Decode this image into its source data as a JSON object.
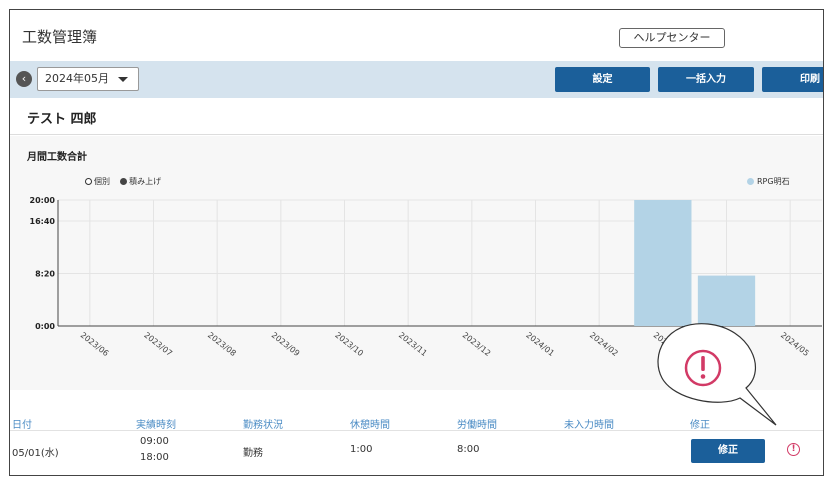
{
  "header": {
    "title": "工数管理簿",
    "help_label": "ヘルプセンター"
  },
  "toolbar": {
    "month": "2024年05月",
    "buttons": [
      {
        "label": "設定"
      },
      {
        "label": "一括入力"
      },
      {
        "label": "印刷"
      }
    ]
  },
  "user": {
    "name": "テスト 四郎"
  },
  "chart": {
    "title": "月間工数合計",
    "mode_individual": "個別",
    "mode_stacked": "積み上げ",
    "series_label": "RPG明石",
    "colors": {
      "bar": "#b3d3e6",
      "grid": "#e4e4e4"
    }
  },
  "chart_data": {
    "type": "bar",
    "categories": [
      "2023/06",
      "2023/07",
      "2023/08",
      "2023/09",
      "2023/10",
      "2023/11",
      "2023/12",
      "2024/01",
      "2024/02",
      "2024/03",
      "2024/04",
      "2024/05"
    ],
    "series": [
      {
        "name": "RPG明石",
        "values": [
          0,
          0,
          0,
          0,
          0,
          0,
          0,
          0,
          0,
          20,
          8,
          0
        ]
      }
    ],
    "yticks": [
      "0:00",
      "8:20",
      "16:40",
      "20:00"
    ],
    "ytick_values": [
      0,
      8.333,
      16.667,
      20
    ],
    "ylim": [
      0,
      20
    ],
    "legend": "top-right"
  },
  "table": {
    "headers": [
      "日付",
      "実績時刻",
      "勤務状況",
      "休憩時間",
      "労働時間",
      "未入力時間",
      "修正"
    ],
    "rows": [
      {
        "date": "05/01(水)",
        "time_start": "09:00",
        "time_end": "18:00",
        "status": "勤務",
        "break": "1:00",
        "work": "8:00",
        "missing": "",
        "fix_label": "修正"
      }
    ]
  },
  "icons": {
    "back": "chevron-left-icon",
    "warning": "exclamation-circle-icon"
  }
}
